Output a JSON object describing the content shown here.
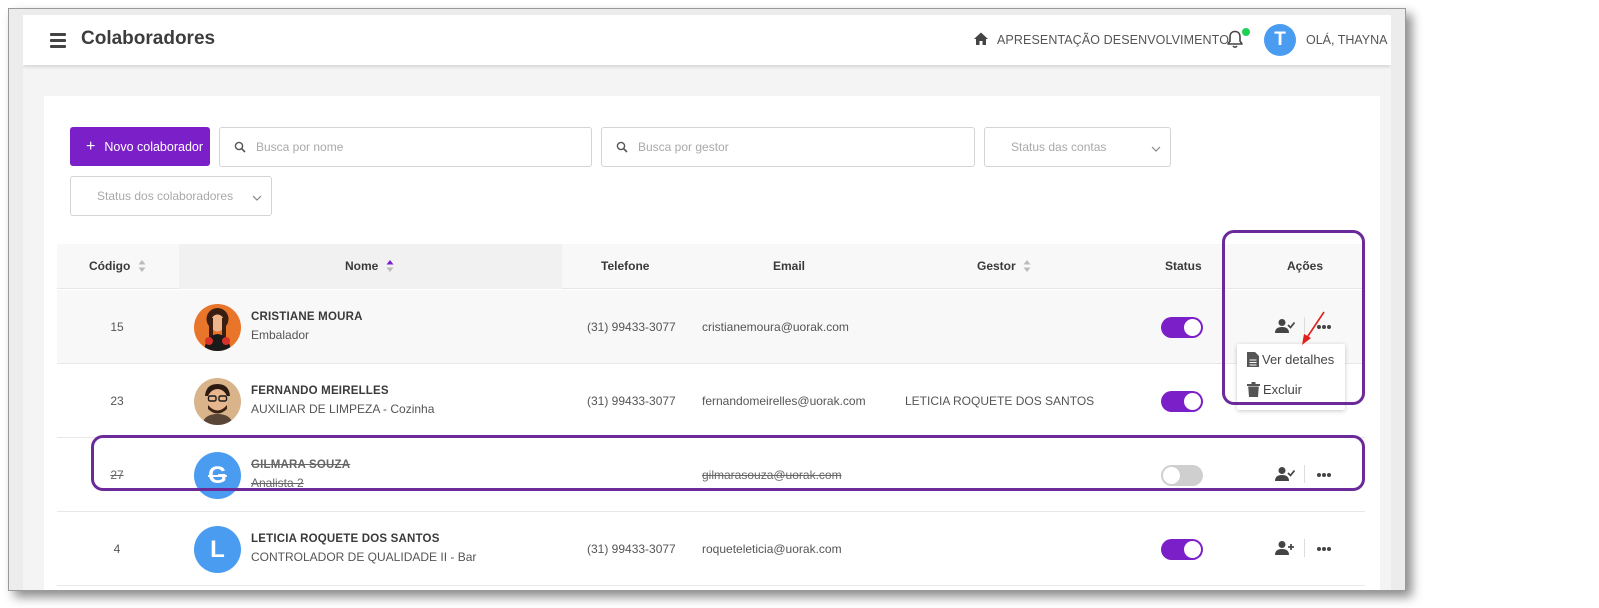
{
  "header": {
    "title": "Colaboradores",
    "company": "APRESENTAÇÃO DESENVOLVIMENTO",
    "greeting": "OLÁ, THAYNA",
    "user_initial": "T"
  },
  "toolbar": {
    "new_label": "Novo colaborador",
    "search_name_placeholder": "Busca por nome",
    "search_manager_placeholder": "Busca por gestor",
    "account_status_label": "Status das contas",
    "employee_status_label": "Status dos colaboradores"
  },
  "table": {
    "columns": [
      "Código",
      "Nome",
      "Telefone",
      "Email",
      "Gestor",
      "Status",
      "Ações"
    ],
    "rows": [
      {
        "code": "15",
        "name": "CRISTIANE MOURA",
        "role": "Embalador",
        "phone": "(31) 99433-3077",
        "email": "cristianemoura@uorak.com",
        "manager": "",
        "active": true,
        "avatar": "photo-female"
      },
      {
        "code": "23",
        "name": "FERNANDO MEIRELLES",
        "role": "AUXILIAR DE LIMPEZA - Cozinha",
        "phone": "(31) 99433-3077",
        "email": "fernandomeirelles@uorak.com",
        "manager": "LETICIA ROQUETE DOS SANTOS",
        "active": true,
        "avatar": "photo-male"
      },
      {
        "code": "27",
        "name": "GILMARA SOUZA",
        "role": "Analista 2",
        "phone": "",
        "email": "gilmarasouza@uorak.com",
        "manager": "",
        "active": false,
        "avatar": "G"
      },
      {
        "code": "4",
        "name": "LETICIA ROQUETE DOS SANTOS",
        "role": "CONTROLADOR DE QUALIDADE II - Bar",
        "phone": "(31) 99433-3077",
        "email": "roqueteleticia@uorak.com",
        "manager": "",
        "active": true,
        "avatar": "L"
      }
    ]
  },
  "menu": {
    "details_label": "Ver detalhes",
    "delete_label": "Excluir"
  },
  "colors": {
    "accent": "#7b1fc9",
    "avatar_blue": "#4a9cf1",
    "annotation": "#6a2a9a",
    "arrow": "#e0201c"
  },
  "icons": [
    "menu-icon",
    "home-icon",
    "bell-icon",
    "search-icon",
    "chevron-down-icon",
    "sort-icon",
    "user-check-icon",
    "user-plus-icon",
    "more-icon",
    "file-icon",
    "trash-icon"
  ]
}
